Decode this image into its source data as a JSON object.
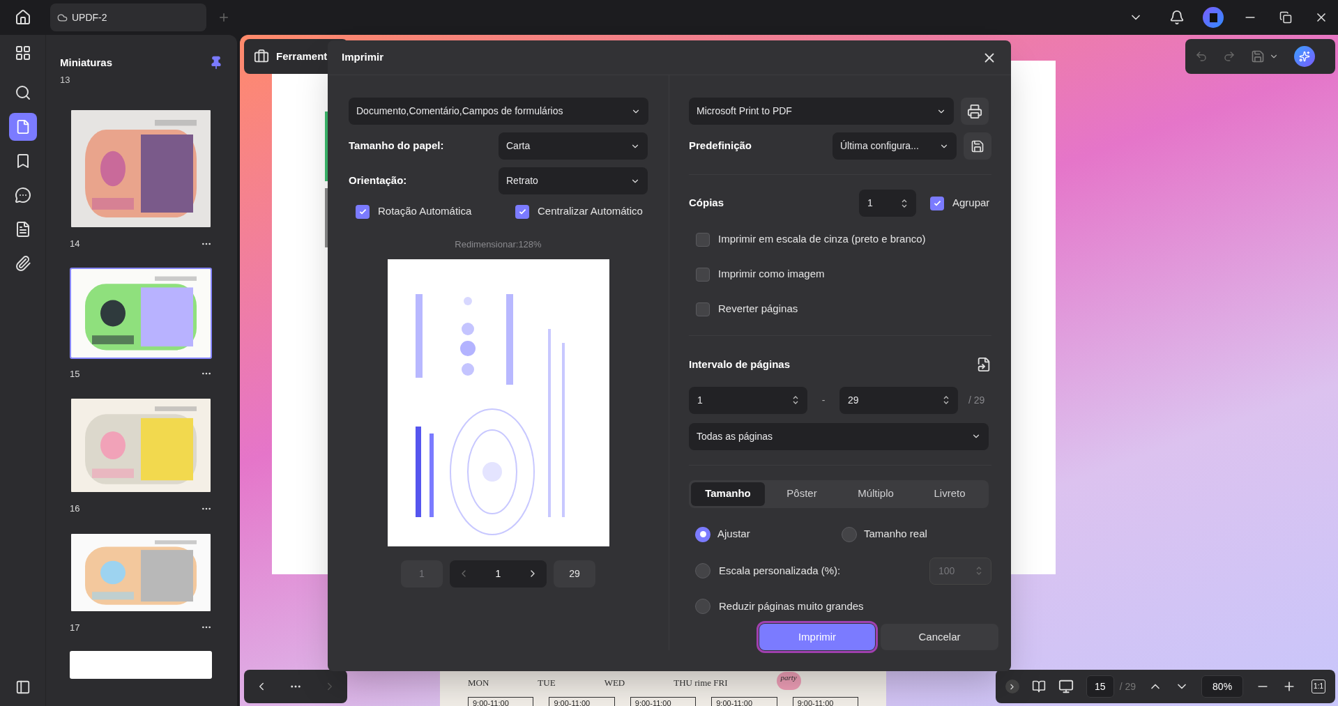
{
  "app_tab": {
    "title": "UPDF-2"
  },
  "sidebar": {
    "title": "Miniaturas",
    "top_label": "13",
    "thumbnails": [
      {
        "label": "14",
        "selected": false
      },
      {
        "label": "15",
        "selected": true
      },
      {
        "label": "16",
        "selected": false
      },
      {
        "label": "17",
        "selected": false
      }
    ]
  },
  "tools_bar": {
    "label": "Ferrament"
  },
  "background_page": {
    "days": [
      "MON",
      "TUE",
      "WED",
      "THU rime FRI"
    ],
    "sticker": "party",
    "times": [
      "9:00-11:00",
      "9:00-11:00",
      "9:00-11:00",
      "9:00-11:00",
      "9:00-11:00"
    ]
  },
  "dialog": {
    "title": "Imprimir",
    "content_select": "Documento,Comentário,Campos de formulários",
    "paper_size": {
      "label": "Tamanho do papel:",
      "value": "Carta"
    },
    "orientation": {
      "label": "Orientação:",
      "value": "Retrato"
    },
    "layout_options": [
      {
        "label": "Rotação Automática",
        "checked": true
      },
      {
        "label": "Centralizar Automático",
        "checked": true
      }
    ],
    "scale_note": "Redimensionar:128%",
    "preview_pager": {
      "first": "1",
      "current": "1",
      "last": "29"
    },
    "printer": "Microsoft Print to PDF",
    "preset": {
      "label": "Predefinição",
      "value": "Última configura..."
    },
    "copies": {
      "label": "Cópias",
      "value": "1",
      "collate_label": "Agrupar",
      "collate": true
    },
    "print_options": [
      {
        "label": "Imprimir em escala de cinza (preto e branco)",
        "checked": false
      },
      {
        "label": "Imprimir como imagem",
        "checked": false
      },
      {
        "label": "Reverter páginas",
        "checked": false
      }
    ],
    "page_range": {
      "label": "Intervalo de páginas",
      "from": "1",
      "separator": "-",
      "to": "29",
      "total": "/ 29",
      "subset": "Todas as páginas"
    },
    "tabs": [
      {
        "label": "Tamanho",
        "selected": true
      },
      {
        "label": "Pôster",
        "selected": false
      },
      {
        "label": "Múltiplo",
        "selected": false
      },
      {
        "label": "Livreto",
        "selected": false
      }
    ],
    "sizing": [
      {
        "label": "Ajustar",
        "selected": true
      },
      {
        "label": "Tamanho real",
        "selected": false
      },
      {
        "label": "Escala personalizada (%):",
        "selected": false
      },
      {
        "label": "Reduzir páginas muito grandes",
        "selected": false
      }
    ],
    "custom_scale": {
      "value": "100",
      "disabled": true
    },
    "buttons": [
      {
        "label": "Imprimir",
        "kind": "primary"
      },
      {
        "label": "Cancelar",
        "kind": "secondary"
      }
    ]
  },
  "status_bar": {
    "page": "15",
    "total": "/ 29",
    "zoom": "80%",
    "actual_size": "1:1"
  }
}
